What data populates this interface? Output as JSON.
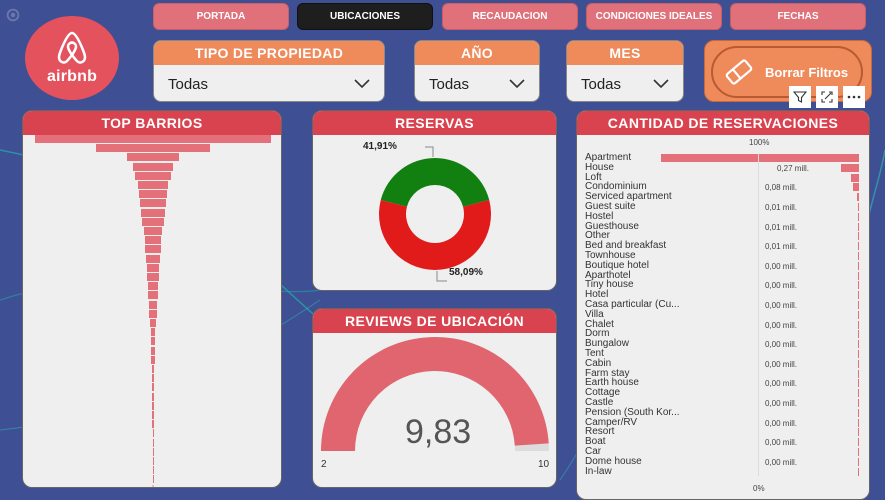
{
  "logo": {
    "wordmark": "airbnb"
  },
  "nav": [
    "PORTADA",
    "UBICACIONES",
    "RECAUDACION",
    "CONDICIONES IDEALES",
    "FECHAS"
  ],
  "slicers": {
    "tipo": {
      "title": "TIPO DE PROPIEDAD",
      "value": "Todas"
    },
    "anio": {
      "title": "AÑO",
      "value": "Todas"
    },
    "mes": {
      "title": "MES",
      "value": "Todas"
    }
  },
  "clear_label": "Borrar Filtros",
  "panels": {
    "barrios": {
      "title": "TOP BARRIOS"
    },
    "reservas": {
      "title": "RESERVAS",
      "label_top": "41,91%",
      "label_bottom": "58,09%"
    },
    "reviews": {
      "title": "REVIEWS DE UBICACIÓN",
      "value": "9,83",
      "min": "2",
      "max": "10"
    },
    "cantidad": {
      "title": "CANTIDAD DE RESERVACIONES",
      "top_pct": "100%",
      "bottom_pct": "0%"
    }
  },
  "colors": {
    "accent": "#d9434f",
    "slicer": "#ef8a5b",
    "green": "#118011",
    "red": "#e11a1a",
    "bar": "#e4707a"
  },
  "chart_data": [
    {
      "type": "bar",
      "title": "TOP BARRIOS",
      "values_relative": [
        1.0,
        0.48,
        0.22,
        0.17,
        0.15,
        0.13,
        0.12,
        0.11,
        0.1,
        0.09,
        0.08,
        0.07,
        0.065,
        0.06,
        0.055,
        0.05,
        0.045,
        0.04,
        0.035,
        0.03,
        0.025,
        0.02,
        0.018,
        0.016,
        0.014,
        0.012,
        0.01,
        0.009,
        0.008,
        0.007,
        0.006,
        0.005,
        0.004,
        0.004,
        0.003,
        0.003,
        0.002,
        0.002
      ]
    },
    {
      "type": "pie",
      "title": "RESERVAS",
      "slices": [
        {
          "value": 41.91,
          "color": "#118011",
          "label": "41,91%"
        },
        {
          "value": 58.09,
          "color": "#e11a1a",
          "label": "58,09%"
        }
      ]
    },
    {
      "type": "gauge",
      "title": "REVIEWS DE UBICACIÓN",
      "value": 9.83,
      "min": 2,
      "max": 10
    },
    {
      "type": "bar",
      "title": "CANTIDAD DE RESERVACIONES",
      "categories": [
        "Apartment",
        "House",
        "Loft",
        "Condominium",
        "Serviced apartment",
        "Guest suite",
        "Hostel",
        "Guesthouse",
        "Other",
        "Bed and breakfast",
        "Townhouse",
        "Boutique hotel",
        "Aparthotel",
        "Tiny house",
        "Hotel",
        "Casa particular (Cu...",
        "Villa",
        "Chalet",
        "Dorm",
        "Bungalow",
        "Tent",
        "Cabin",
        "Farm stay",
        "Earth house",
        "Cottage",
        "Castle",
        "Pension (South Kor...",
        "Camper/RV",
        "Resort",
        "Boat",
        "Car",
        "Dome house",
        "In-law"
      ],
      "values_relative": [
        1.0,
        0.09,
        0.04,
        0.03,
        0.012,
        0.006,
        0.005,
        0.005,
        0.004,
        0.004,
        0.003,
        0.003,
        0.002,
        0.002,
        0.002,
        0.002,
        0.002,
        0.001,
        0.001,
        0.001,
        0.001,
        0.001,
        0.001,
        0.001,
        0.001,
        0.001,
        0.001,
        0.001,
        0.001,
        0.001,
        0.001,
        0.001,
        0.001
      ],
      "value_labels": [
        "",
        "0,27 mill.",
        "",
        "0,08 mill.",
        "",
        "0,01 mill.",
        "",
        "0,01 mill.",
        "",
        "0,01 mill.",
        "",
        "0,00 mill.",
        "",
        "0,00 mill.",
        "",
        "0,00 mill.",
        "",
        "0,00 mill.",
        "",
        "0,00 mill.",
        "",
        "0,00 mill.",
        "",
        "0,00 mill.",
        "",
        "0,00 mill.",
        "",
        "0,00 mill.",
        "",
        "0,00 mill.",
        "",
        "0,00 mill.",
        ""
      ]
    }
  ]
}
